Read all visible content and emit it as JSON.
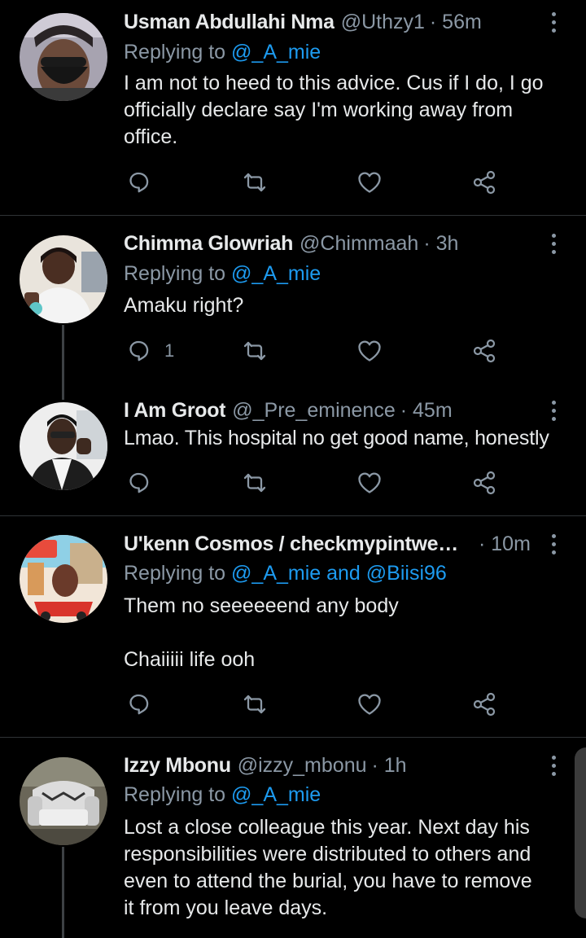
{
  "tweets": [
    {
      "name": "Usman Abdullahi Nma",
      "handle": "@Uthzy1",
      "time": "· 56m",
      "replying_prefix": "Replying to ",
      "replying_to": "@_A_mie",
      "text": "I am not to heed to this advice. Cus if I do, I go officially declare say I'm working away from office.",
      "reply_count": ""
    },
    {
      "name": "Chimma Glowriah",
      "handle": "@Chimmaah",
      "time": "· 3h",
      "replying_prefix": "Replying to ",
      "replying_to": "@_A_mie",
      "text": "Amaku right?",
      "reply_count": "1"
    },
    {
      "name": "I Am Groot",
      "handle": "@_Pre_eminence",
      "time": "· 45m",
      "text": "Lmao. This hospital no get good name, honestly",
      "reply_count": ""
    },
    {
      "name": "U'kenn Cosmos / checkmypintweet ...",
      "handle": "",
      "time": "· 10m",
      "replying_prefix": "Replying to ",
      "replying_to": "@_A_mie and @Biisi96",
      "text": "Them no seeeeeend any body\n\nChaiiiii life ooh",
      "reply_count": ""
    },
    {
      "name": "Izzy Mbonu",
      "handle": "@izzy_mbonu",
      "time": "· 1h",
      "replying_prefix": "Replying to ",
      "replying_to": "@_A_mie",
      "text": "Lost a close colleague this year. Next day his responsibilities were distributed to others and even to attend the burial, you have to remove it from you leave days.",
      "reply_count": ""
    }
  ],
  "icons": {
    "reply": "reply-icon",
    "retweet": "retweet-icon",
    "like": "heart-icon",
    "share": "share-icon",
    "more": "more-dots-icon"
  },
  "colors": {
    "background": "#000000",
    "text": "#e7e9ea",
    "secondary": "#8b98a5",
    "mention": "#1d9bf0",
    "divider": "#2f3336"
  }
}
